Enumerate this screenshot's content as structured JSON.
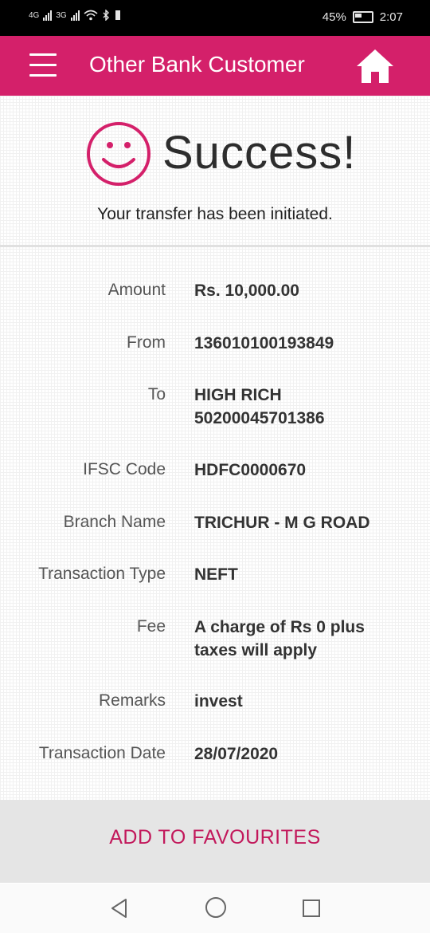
{
  "status_bar": {
    "net1": "4G",
    "net2": "3G",
    "battery": "45%",
    "time": "2:07"
  },
  "app_bar": {
    "title": "Other Bank Customer",
    "menu_icon": "hamburger-menu-icon",
    "home_icon": "home-icon",
    "color": "#d4206a"
  },
  "result": {
    "icon": "smiley-icon",
    "heading": "Success!",
    "message": "Your transfer has been initiated."
  },
  "details": [
    {
      "label": "Amount",
      "lines": [
        "Rs. 10,000.00"
      ]
    },
    {
      "label": "From",
      "lines": [
        "136010100193849"
      ]
    },
    {
      "label": "To",
      "lines": [
        "HIGH RICH",
        "50200045701386"
      ]
    },
    {
      "label": "IFSC Code",
      "lines": [
        "HDFC0000670"
      ]
    },
    {
      "label": "Branch Name",
      "lines": [
        "TRICHUR - M G ROAD"
      ]
    },
    {
      "label": "Transaction Type",
      "lines": [
        "NEFT"
      ]
    },
    {
      "label": "Fee",
      "lines": [
        "A charge of Rs 0 plus",
        "taxes will apply"
      ]
    },
    {
      "label": "Remarks",
      "lines": [
        "invest"
      ]
    },
    {
      "label": "Transaction Date",
      "lines": [
        "28/07/2020"
      ]
    }
  ],
  "actions": {
    "add_to_favourites": "ADD TO FAVOURITES"
  },
  "nav": {
    "back": "back-triangle-icon",
    "home": "home-circle-icon",
    "recents": "recents-square-icon"
  }
}
